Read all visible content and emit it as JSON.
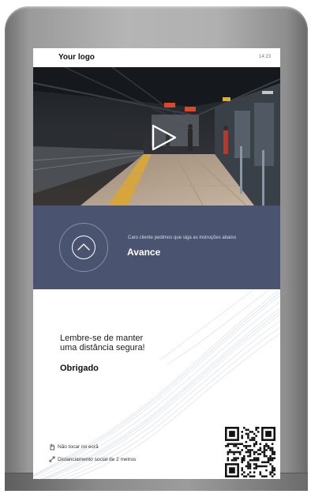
{
  "screen": {
    "logo": "Your logo",
    "time": "14:23"
  },
  "video": {
    "play_icon": "play-icon"
  },
  "banner": {
    "instruction": "Caro cliente pedimos que siga as instruções abaixo",
    "action": "Avance",
    "icon": "chevron-up-icon",
    "color": "#4a5470"
  },
  "message": {
    "line1": "Lembre-se de manter",
    "line2": "uma distância segura!",
    "thanks": "Obrigado"
  },
  "notes": [
    {
      "icon": "hand-icon",
      "text": "Não tocar no ecrã"
    },
    {
      "icon": "distance-arrow-icon",
      "text": "Distanciamento social de 2 metros"
    }
  ],
  "qr_icon": "qr-code-icon"
}
